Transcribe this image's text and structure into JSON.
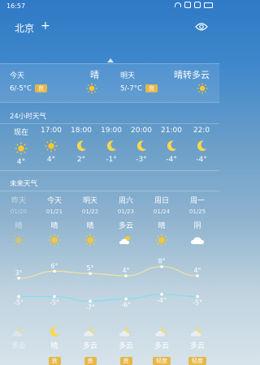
{
  "status": {
    "time": "16:57"
  },
  "header": {
    "city": "北京",
    "add_label": "+"
  },
  "today": {
    "label": "今天",
    "weather": "晴",
    "temp": "6/-5°C",
    "aqi": "良"
  },
  "tomorrow": {
    "label": "明天",
    "weather": "晴转多云",
    "temp": "5/-7°C",
    "aqi": "良"
  },
  "hourly": {
    "title": "24小时天气",
    "items": [
      {
        "time": "现在",
        "icon": "sun-icon",
        "temp": "4°"
      },
      {
        "time": "17:00",
        "icon": "sun-icon",
        "temp": "4°"
      },
      {
        "time": "18:00",
        "icon": "moon-icon",
        "temp": "2°"
      },
      {
        "time": "19:00",
        "icon": "moon-icon",
        "temp": "-1°"
      },
      {
        "time": "20:00",
        "icon": "moon-icon",
        "temp": "-3°"
      },
      {
        "time": "21:00",
        "icon": "moon-icon",
        "temp": "-4°"
      },
      {
        "time": "22:0",
        "icon": "moon-icon",
        "temp": "-4°"
      }
    ]
  },
  "forecast": {
    "title": "未来天气",
    "days": [
      {
        "name": "昨天",
        "date": "01/20",
        "day_icon": "sun-icon",
        "day_text": "晴",
        "high": "3°",
        "low": "-5°",
        "night_icon": "partly-cloudy-night-icon",
        "night_text": "多云",
        "aqi": ""
      },
      {
        "name": "今天",
        "date": "01/21",
        "day_icon": "sun-icon",
        "day_text": "晴",
        "high": "6°",
        "low": "-5°",
        "night_icon": "moon-icon",
        "night_text": "晴",
        "aqi": "良"
      },
      {
        "name": "明天",
        "date": "01/22",
        "day_icon": "sun-icon",
        "day_text": "晴",
        "high": "5°",
        "low": "-7°",
        "night_icon": "partly-cloudy-night-icon",
        "night_text": "多云",
        "aqi": "良"
      },
      {
        "name": "周六",
        "date": "01/23",
        "day_icon": "partly-cloudy-icon",
        "day_text": "多云",
        "high": "4°",
        "low": "-6°",
        "night_icon": "partly-cloudy-night-icon",
        "night_text": "多云",
        "aqi": "良"
      },
      {
        "name": "周日",
        "date": "01/24",
        "day_icon": "sun-icon",
        "day_text": "晴",
        "high": "8°",
        "low": "-4°",
        "night_icon": "partly-cloudy-night-icon",
        "night_text": "多云",
        "aqi": "轻度"
      },
      {
        "name": "周一",
        "date": "01/25",
        "day_icon": "cloud-icon",
        "day_text": "阴",
        "high": "4°",
        "low": "-5°",
        "night_icon": "partly-cloudy-night-icon",
        "night_text": "多云",
        "aqi": "轻度"
      }
    ],
    "high_values": [
      3,
      6,
      5,
      4,
      8,
      4
    ],
    "low_values": [
      -5,
      -5,
      -7,
      -6,
      -4,
      -5
    ]
  },
  "colors": {
    "sun": "#ffc928",
    "moon": "#ffd84a",
    "aqi_badge": "#e6b84a",
    "high_line": "#f5e39a",
    "low_line": "#7fe0f0"
  }
}
